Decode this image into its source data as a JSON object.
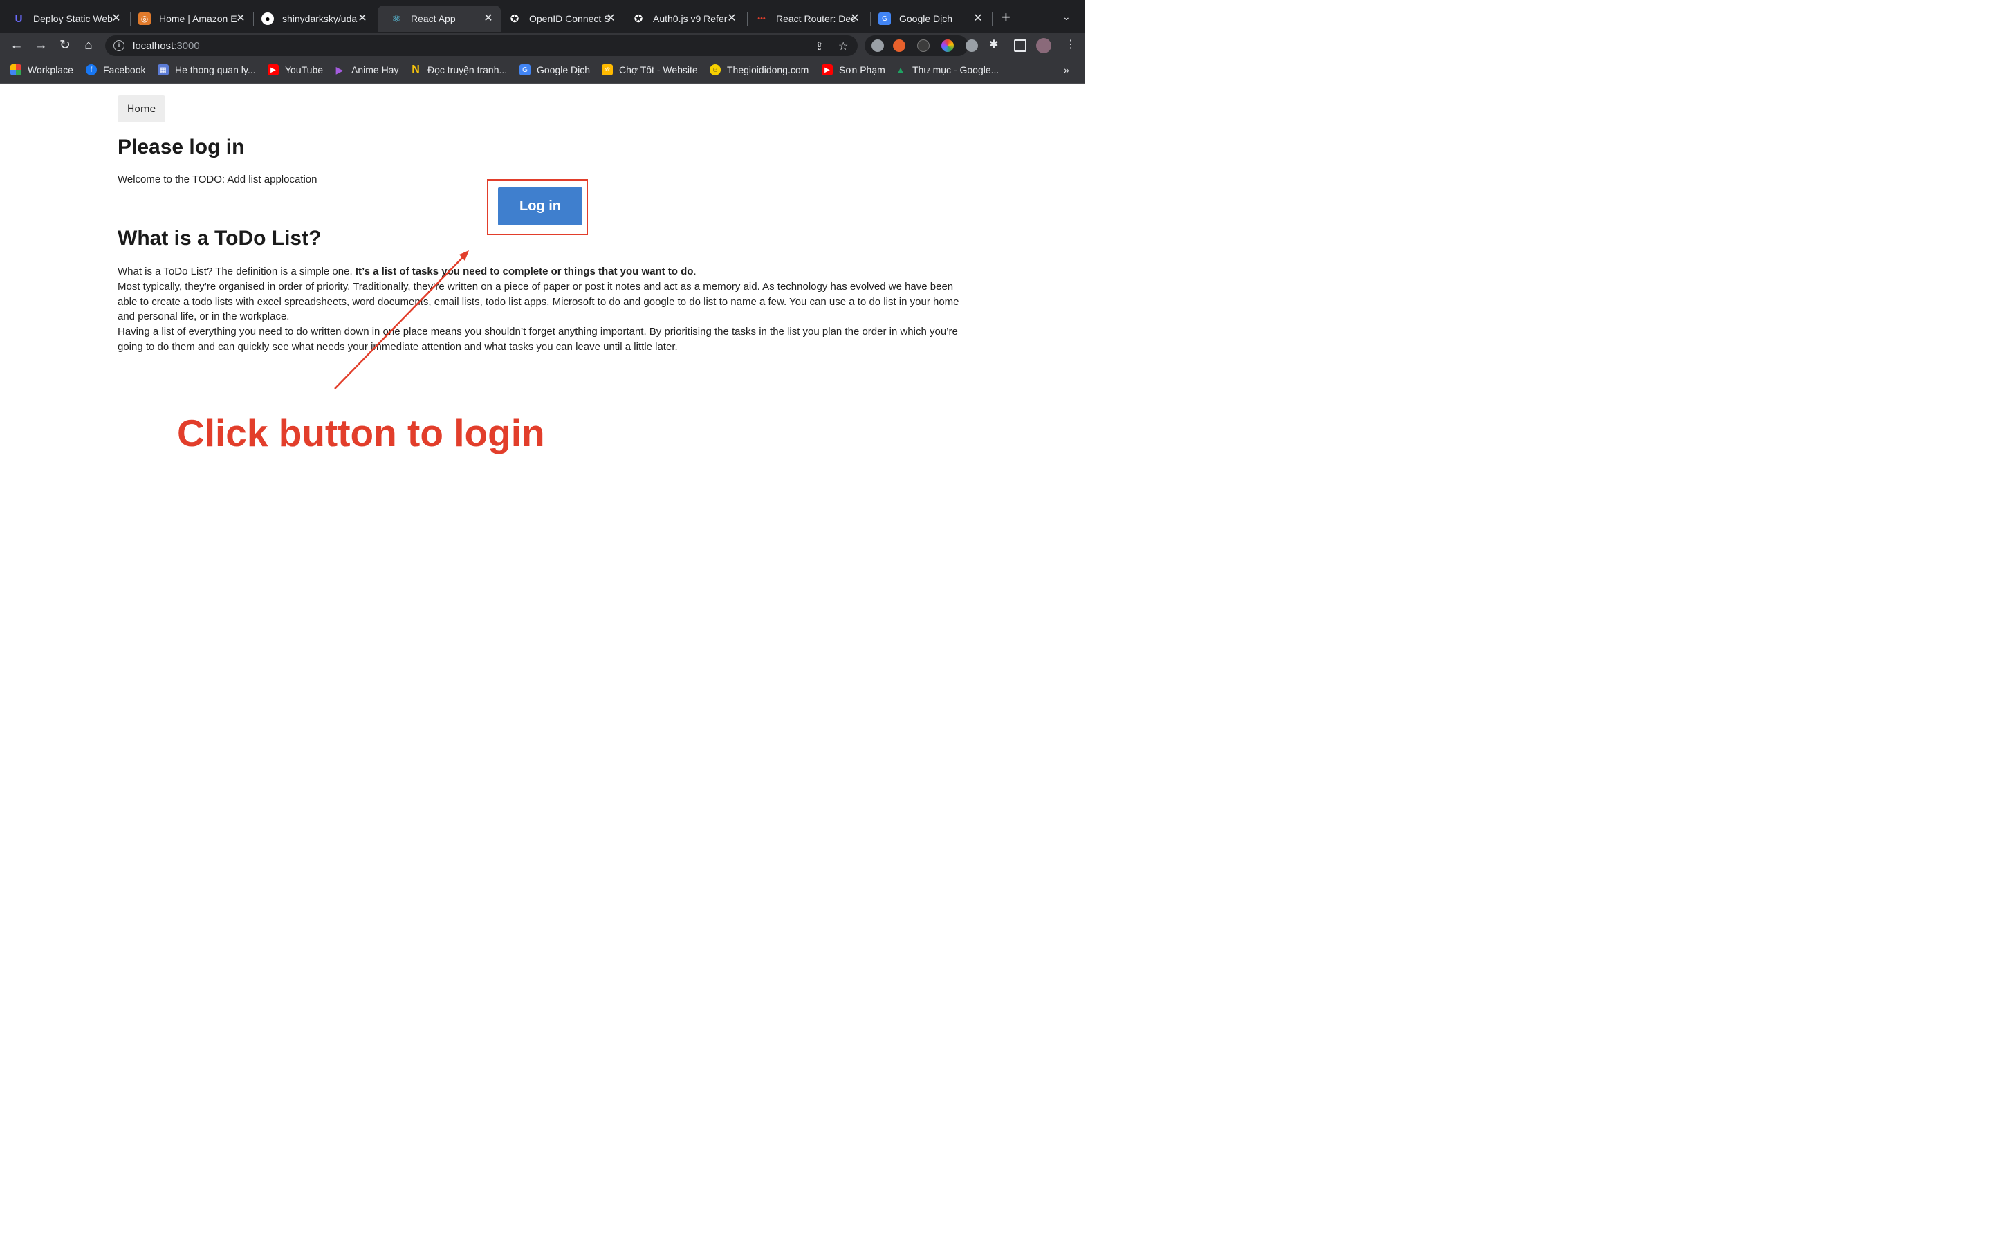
{
  "browser": {
    "tabs": [
      {
        "title": "Deploy Static Web",
        "icon": "udacity-icon",
        "active": false
      },
      {
        "title": "Home | Amazon E",
        "icon": "aws-icon",
        "active": false
      },
      {
        "title": "shinydarksky/uda",
        "icon": "github-icon",
        "active": false
      },
      {
        "title": "React App",
        "icon": "react-icon",
        "active": true
      },
      {
        "title": "OpenID Connect S",
        "icon": "auth0-icon",
        "active": false
      },
      {
        "title": "Auth0.js v9 Refer",
        "icon": "auth0-icon",
        "active": false
      },
      {
        "title": "React Router: Dec",
        "icon": "react-router-icon",
        "active": false
      },
      {
        "title": "Google Dịch",
        "icon": "google-translate-icon",
        "active": false
      }
    ],
    "address": {
      "host": "localhost",
      "port": ":3000"
    },
    "bookmarks": [
      {
        "label": "Workplace",
        "icon": "workplace-icon",
        "color": "#e94235"
      },
      {
        "label": "Facebook",
        "icon": "facebook-icon",
        "color": "#1877f2"
      },
      {
        "label": "He thong quan ly...",
        "icon": "grid-icon",
        "color": "#5b7bd5"
      },
      {
        "label": "YouTube",
        "icon": "youtube-icon",
        "color": "#ff0000"
      },
      {
        "label": "Anime Hay",
        "icon": "play-icon",
        "color": "#8e44ad"
      },
      {
        "label": "Đọc truyện tranh...",
        "icon": "n-icon",
        "color": "#f4c20d"
      },
      {
        "label": "Google Dịch",
        "icon": "google-translate-icon",
        "color": "#4285f4"
      },
      {
        "label": "Chợ Tốt - Website",
        "icon": "chotot-icon",
        "color": "#ffba00"
      },
      {
        "label": "Thegioididong.com",
        "icon": "tgdd-icon",
        "color": "#f6d000"
      },
      {
        "label": "Sơn Phạm",
        "icon": "youtube-icon",
        "color": "#ff0000"
      },
      {
        "label": "Thư mục - Google...",
        "icon": "drive-icon",
        "color": "#1fa463"
      }
    ],
    "more_bookmarks": "»"
  },
  "page": {
    "home_label": "Home",
    "title": "Please log in",
    "welcome": "Welcome to the TODO: Add list applocation",
    "login_label": "Log in",
    "section_title": "What is a ToDo List?",
    "p1_start": "What is a ToDo List? The definition is a simple one. ",
    "p1_bold": "It’s a list of tasks you need to complete or things that you want to do",
    "p1_end": ".",
    "p2": "Most typically, they’re organised in order of priority. Traditionally, they’re written on a piece of paper or post it notes and act as a memory aid. As technology has evolved we have been able to create a todo lists with excel spreadsheets, word documents, email lists, todo list apps, Microsoft to do and google to do list to name a few. You can use a to do list in your home and personal life, or in the workplace.",
    "p3": "Having a list of everything you need to do written down in one place means you shouldn’t forget anything important. By prioritising the tasks in the list you plan the order in which you’re going to do them and can quickly see what needs your immediate attention and what tasks you can leave until a little later."
  },
  "annotation": {
    "text": "Click button to login",
    "color": "#e23e2b"
  }
}
